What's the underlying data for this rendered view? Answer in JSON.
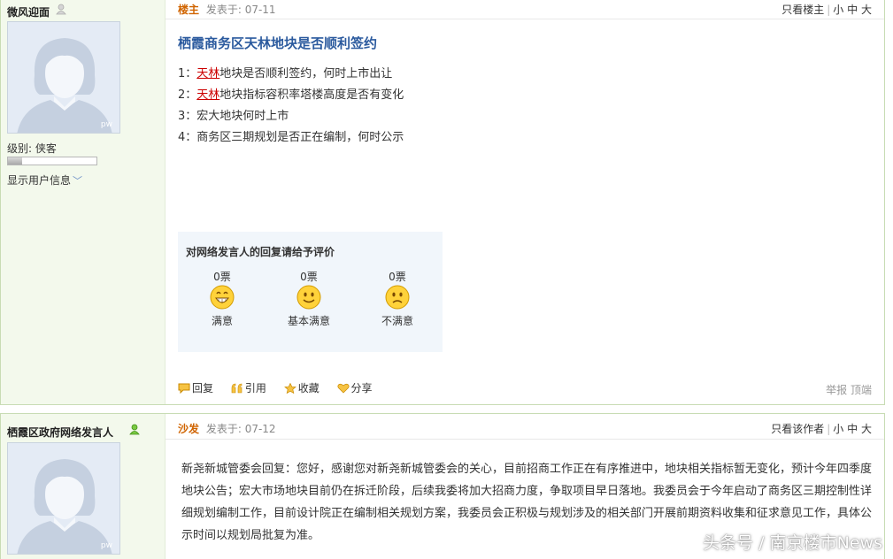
{
  "post1": {
    "user": {
      "name": "微风迎面",
      "level_label": "级别: 侠客",
      "show_info": "显示用户信息",
      "avatar_mark": "pw"
    },
    "meta": {
      "tag": "楼主",
      "posted": "发表于: 07-11"
    },
    "top_right": {
      "only_view": "只看楼主",
      "size_small": "小",
      "size_mid": "中",
      "size_large": "大"
    },
    "title": "栖霞商务区天林地块是否顺利签约",
    "items": [
      {
        "num": "1：",
        "highlight": "天林",
        "text": "地块是否顺利签约，何时上市出让"
      },
      {
        "num": "2：",
        "highlight": "天林",
        "text": "地块指标容积率塔楼高度是否有变化"
      },
      {
        "num": "3：",
        "highlight": "",
        "text": "宏大地块何时上市"
      },
      {
        "num": "4：",
        "highlight": "",
        "text": "商务区三期规划是否正在编制，何时公示"
      }
    ],
    "rating": {
      "title": "对网络发言人的回复请给予评价",
      "options": [
        {
          "votes": "0票",
          "label": "满意"
        },
        {
          "votes": "0票",
          "label": "基本满意"
        },
        {
          "votes": "0票",
          "label": "不满意"
        }
      ]
    },
    "actions": {
      "reply": "回复",
      "quote": "引用",
      "favorite": "收藏",
      "share": "分享",
      "report": "举报",
      "top": "顶端"
    }
  },
  "post2": {
    "user": {
      "name": "栖霞区政府网络发言人",
      "avatar_mark": "pw"
    },
    "meta": {
      "tag": "沙发",
      "posted": "发表于: 07-12"
    },
    "top_right": {
      "only_view": "只看该作者",
      "size_small": "小",
      "size_mid": "中",
      "size_large": "大"
    },
    "body": "新尧新城管委会回复：您好，感谢您对新尧新城管委会的关心，目前招商工作正在有序推进中，地块相关指标暂无变化，预计今年四季度地块公告；宏大市场地块目前仍在拆迁阶段，后续我委将加大招商力度，争取项目早日落地。我委员会于今年启动了商务区三期控制性详细规划编制工作，目前设计院正在编制相关规划方案，我委员会正积极与规划涉及的相关部门开展前期资料收集和征求意见工作，具体公示时间以规划局批复为准。"
  },
  "watermark": "头条号 / 南京楼市News"
}
